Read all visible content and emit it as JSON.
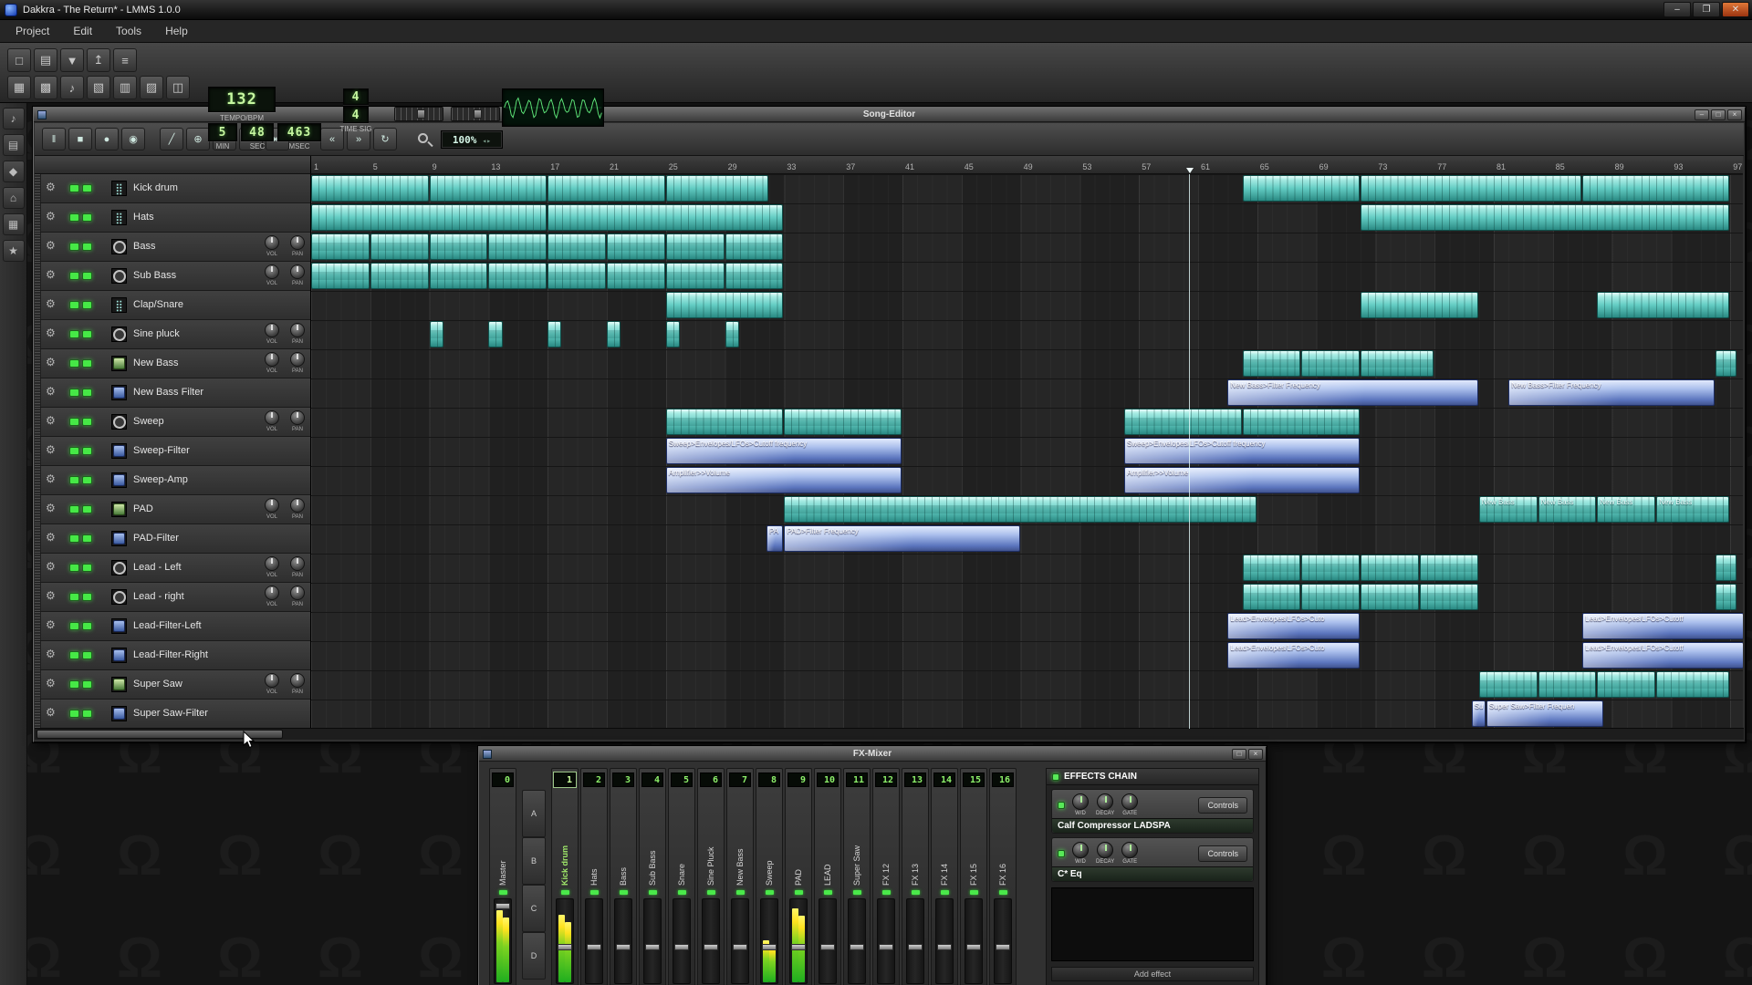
{
  "titlebar": {
    "title": "Dakkra - The Return* - LMMS 1.0.0"
  },
  "menubar": {
    "items": [
      "Project",
      "Edit",
      "Tools",
      "Help"
    ]
  },
  "toolbar": {
    "buttons_row1": [
      "new-project",
      "open-project",
      "save-project",
      "export-project",
      "project-properties"
    ],
    "buttons_row2": [
      "song-editor",
      "bb-editor",
      "piano-roll",
      "automation-editor",
      "fx-mixer",
      "project-notes",
      "controller-rack"
    ],
    "tempo": {
      "value": "132",
      "label": "TEMPO/BPM"
    },
    "time": {
      "min": "5",
      "sec": "48",
      "msec": "463",
      "labels": {
        "min": "MIN",
        "sec": "SEC",
        "msec": "MSEC"
      }
    },
    "timesig": {
      "numerator": "4",
      "denominator": "4",
      "label": "TIME SIG"
    },
    "sliders": [
      "master-volume",
      "master-pitch"
    ]
  },
  "sidebar": {
    "items": [
      "instruments",
      "samples",
      "presets",
      "home",
      "computer",
      "star"
    ]
  },
  "song_editor": {
    "title": "Song-Editor",
    "toolbar": {
      "transport": [
        "pause",
        "stop",
        "record",
        "record-play"
      ],
      "edit": [
        "draw-mode",
        "edit-mode",
        "add-track",
        "insert-bar",
        "remove-bar"
      ],
      "nav": [
        "jump-start",
        "jump-end",
        "loop"
      ],
      "zoom_value": "100%"
    },
    "knob_labels": [
      "VOL",
      "PAN"
    ],
    "bar_numbers": [
      1,
      5,
      9,
      13,
      17,
      21,
      25,
      29,
      33,
      37,
      41,
      45,
      49,
      53,
      57,
      61,
      65,
      69,
      73,
      77,
      81,
      85,
      89,
      93,
      97
    ],
    "playhead_bar": 60.4,
    "tracks": [
      {
        "name": "Kick drum",
        "icon": "beat",
        "knobs": false,
        "ptype": "beat",
        "patterns": [
          {
            "s": 1,
            "l": 8
          },
          {
            "s": 9,
            "l": 8
          },
          {
            "s": 17,
            "l": 8
          },
          {
            "s": 25,
            "l": 7
          },
          {
            "s": 64,
            "l": 8
          },
          {
            "s": 72,
            "l": 15
          },
          {
            "s": 87,
            "l": 10
          }
        ]
      },
      {
        "name": "Hats",
        "icon": "beat",
        "knobs": false,
        "ptype": "beat",
        "patterns": [
          {
            "s": 1,
            "l": 16
          },
          {
            "s": 17,
            "l": 16
          },
          {
            "s": 72,
            "l": 25
          }
        ]
      },
      {
        "name": "Bass",
        "icon": "osc",
        "knobs": true,
        "ptype": "note",
        "patterns": [
          {
            "s": 1,
            "l": 4
          },
          {
            "s": 5,
            "l": 4
          },
          {
            "s": 9,
            "l": 4
          },
          {
            "s": 13,
            "l": 4
          },
          {
            "s": 17,
            "l": 4
          },
          {
            "s": 21,
            "l": 4
          },
          {
            "s": 25,
            "l": 4
          },
          {
            "s": 29,
            "l": 4
          }
        ]
      },
      {
        "name": "Sub Bass",
        "icon": "osc",
        "knobs": true,
        "ptype": "note",
        "patterns": [
          {
            "s": 1,
            "l": 4
          },
          {
            "s": 5,
            "l": 4
          },
          {
            "s": 9,
            "l": 4
          },
          {
            "s": 13,
            "l": 4
          },
          {
            "s": 17,
            "l": 4
          },
          {
            "s": 21,
            "l": 4
          },
          {
            "s": 25,
            "l": 4
          },
          {
            "s": 29,
            "l": 4
          }
        ]
      },
      {
        "name": "Clap/Snare",
        "icon": "beat",
        "knobs": false,
        "ptype": "beat",
        "patterns": [
          {
            "s": 25,
            "l": 8
          },
          {
            "s": 72,
            "l": 8
          },
          {
            "s": 88,
            "l": 9
          }
        ]
      },
      {
        "name": "Sine pluck",
        "icon": "osc",
        "knobs": true,
        "ptype": "note",
        "patterns": [
          {
            "s": 9,
            "l": 1
          },
          {
            "s": 13,
            "l": 1
          },
          {
            "s": 17,
            "l": 1
          },
          {
            "s": 21,
            "l": 1
          },
          {
            "s": 25,
            "l": 1
          },
          {
            "s": 29,
            "l": 1
          }
        ]
      },
      {
        "name": "New Bass",
        "icon": "zyn",
        "knobs": true,
        "ptype": "note",
        "patterns": [
          {
            "s": 64,
            "l": 4
          },
          {
            "s": 68,
            "l": 4
          },
          {
            "s": 72,
            "l": 5
          },
          {
            "s": 96,
            "l": 1.5
          }
        ]
      },
      {
        "name": "New Bass Filter",
        "icon": "auto",
        "knobs": false,
        "ptype": "auto",
        "patterns": [
          {
            "s": 63,
            "l": 17,
            "label": "New Bass>Filter Frequency"
          },
          {
            "s": 82,
            "l": 14,
            "label": "New Bass>Filter Frequency"
          }
        ]
      },
      {
        "name": "Sweep",
        "icon": "osc",
        "knobs": true,
        "ptype": "note",
        "patterns": [
          {
            "s": 25,
            "l": 8
          },
          {
            "s": 33,
            "l": 8
          },
          {
            "s": 56,
            "l": 8
          },
          {
            "s": 64,
            "l": 8
          }
        ]
      },
      {
        "name": "Sweep-Filter",
        "icon": "auto",
        "knobs": false,
        "ptype": "auto",
        "patterns": [
          {
            "s": 25,
            "l": 16,
            "label": "Sweep>Envelopes/LFOs>Cutoff frequency"
          },
          {
            "s": 56,
            "l": 16,
            "label": "Sweep>Envelopes/LFOs>Cutoff frequency"
          }
        ]
      },
      {
        "name": "Sweep-Amp",
        "icon": "auto",
        "knobs": false,
        "ptype": "auto",
        "patterns": [
          {
            "s": 25,
            "l": 16,
            "label": "Amplifier>>Volume"
          },
          {
            "s": 56,
            "l": 16,
            "label": "Amplifier>>Volume"
          }
        ]
      },
      {
        "name": "PAD",
        "icon": "zyn",
        "knobs": true,
        "ptype": "note",
        "patterns": [
          {
            "s": 33,
            "l": 32
          },
          {
            "s": 80,
            "l": 4,
            "label": "New Bass"
          },
          {
            "s": 84,
            "l": 4,
            "label": "New Bass"
          },
          {
            "s": 88,
            "l": 4,
            "label": "New Bass"
          },
          {
            "s": 92,
            "l": 5,
            "label": "New Bass"
          }
        ]
      },
      {
        "name": "PAD-Filter",
        "icon": "auto",
        "knobs": false,
        "ptype": "auto",
        "patterns": [
          {
            "s": 31.8,
            "l": 1.2,
            "label": "PA"
          },
          {
            "s": 33,
            "l": 16,
            "label": "PAD>Filter Frequency"
          }
        ]
      },
      {
        "name": "Lead - Left",
        "icon": "osc",
        "knobs": true,
        "ptype": "note",
        "patterns": [
          {
            "s": 64,
            "l": 4
          },
          {
            "s": 68,
            "l": 4
          },
          {
            "s": 72,
            "l": 4
          },
          {
            "s": 76,
            "l": 4
          },
          {
            "s": 96,
            "l": 1.5
          }
        ]
      },
      {
        "name": "Lead - right",
        "icon": "osc",
        "knobs": true,
        "ptype": "note",
        "patterns": [
          {
            "s": 64,
            "l": 4
          },
          {
            "s": 68,
            "l": 4
          },
          {
            "s": 72,
            "l": 4
          },
          {
            "s": 76,
            "l": 4
          },
          {
            "s": 96,
            "l": 1.5
          }
        ]
      },
      {
        "name": "Lead-Filter-Left",
        "icon": "auto",
        "knobs": false,
        "ptype": "auto",
        "patterns": [
          {
            "s": 63,
            "l": 9,
            "label": "Lead>Envelopes/LFOs>Cuto"
          },
          {
            "s": 87,
            "l": 11,
            "label": "Lead>Envelopes/LFOs>Cutoff"
          }
        ]
      },
      {
        "name": "Lead-Filter-Right",
        "icon": "auto",
        "knobs": false,
        "ptype": "auto",
        "patterns": [
          {
            "s": 63,
            "l": 9,
            "label": "Lead>Envelopes/LFOs>Cuto"
          },
          {
            "s": 87,
            "l": 11,
            "label": "Lead>Envelopes/LFOs>Cutoff"
          }
        ]
      },
      {
        "name": "Super Saw",
        "icon": "zyn",
        "knobs": true,
        "ptype": "note",
        "patterns": [
          {
            "s": 80,
            "l": 4
          },
          {
            "s": 84,
            "l": 4
          },
          {
            "s": 88,
            "l": 4
          },
          {
            "s": 92,
            "l": 5
          }
        ]
      },
      {
        "name": "Super Saw-Filter",
        "icon": "auto",
        "knobs": false,
        "ptype": "auto",
        "patterns": [
          {
            "s": 79.5,
            "l": 1,
            "label": "Su"
          },
          {
            "s": 80.5,
            "l": 8,
            "label": "Super Saw>Filter Frequen"
          }
        ]
      }
    ]
  },
  "fx_mixer": {
    "title": "FX-Mixer",
    "banks": [
      "A",
      "B",
      "C",
      "D"
    ],
    "channels": [
      {
        "num": "0",
        "name": "Master",
        "selected": false,
        "meter": 0.86,
        "fader": 0.05
      },
      {
        "num": "1",
        "name": "Kick drum",
        "selected": true,
        "meter": 0.8,
        "fader": 0.62
      },
      {
        "num": "2",
        "name": "Hats",
        "selected": false,
        "meter": 0,
        "fader": 0.62
      },
      {
        "num": "3",
        "name": "Bass",
        "selected": false,
        "meter": 0,
        "fader": 0.62
      },
      {
        "num": "4",
        "name": "Sub Bass",
        "selected": false,
        "meter": 0,
        "fader": 0.62
      },
      {
        "num": "5",
        "name": "Snare",
        "selected": false,
        "meter": 0,
        "fader": 0.62
      },
      {
        "num": "6",
        "name": "Sine Pluck",
        "selected": false,
        "meter": 0,
        "fader": 0.62
      },
      {
        "num": "7",
        "name": "New Bass",
        "selected": false,
        "meter": 0,
        "fader": 0.62
      },
      {
        "num": "8",
        "name": "Sweep",
        "selected": false,
        "meter": 0.5,
        "fader": 0.62
      },
      {
        "num": "9",
        "name": "PAD",
        "selected": false,
        "meter": 0.88,
        "fader": 0.62
      },
      {
        "num": "10",
        "name": "LEAD",
        "selected": false,
        "meter": 0,
        "fader": 0.62
      },
      {
        "num": "11",
        "name": "Super Saw",
        "selected": false,
        "meter": 0,
        "fader": 0.62
      },
      {
        "num": "12",
        "name": "FX 12",
        "selected": false,
        "meter": 0,
        "fader": 0.62
      },
      {
        "num": "13",
        "name": "FX 13",
        "selected": false,
        "meter": 0,
        "fader": 0.62
      },
      {
        "num": "14",
        "name": "FX 14",
        "selected": false,
        "meter": 0,
        "fader": 0.62
      },
      {
        "num": "15",
        "name": "FX 15",
        "selected": false,
        "meter": 0,
        "fader": 0.62
      },
      {
        "num": "16",
        "name": "FX 16",
        "selected": false,
        "meter": 0,
        "fader": 0.62
      }
    ],
    "effects_chain": {
      "header": "EFFECTS CHAIN",
      "units": [
        {
          "name": "Calf Compressor LADSPA",
          "knob_labels": [
            "W/D",
            "DECAY",
            "GATE"
          ],
          "button": "Controls"
        },
        {
          "name": "C* Eq",
          "knob_labels": [
            "W/D",
            "DECAY",
            "GATE"
          ],
          "button": "Controls"
        }
      ],
      "add_label": "Add effect"
    }
  }
}
